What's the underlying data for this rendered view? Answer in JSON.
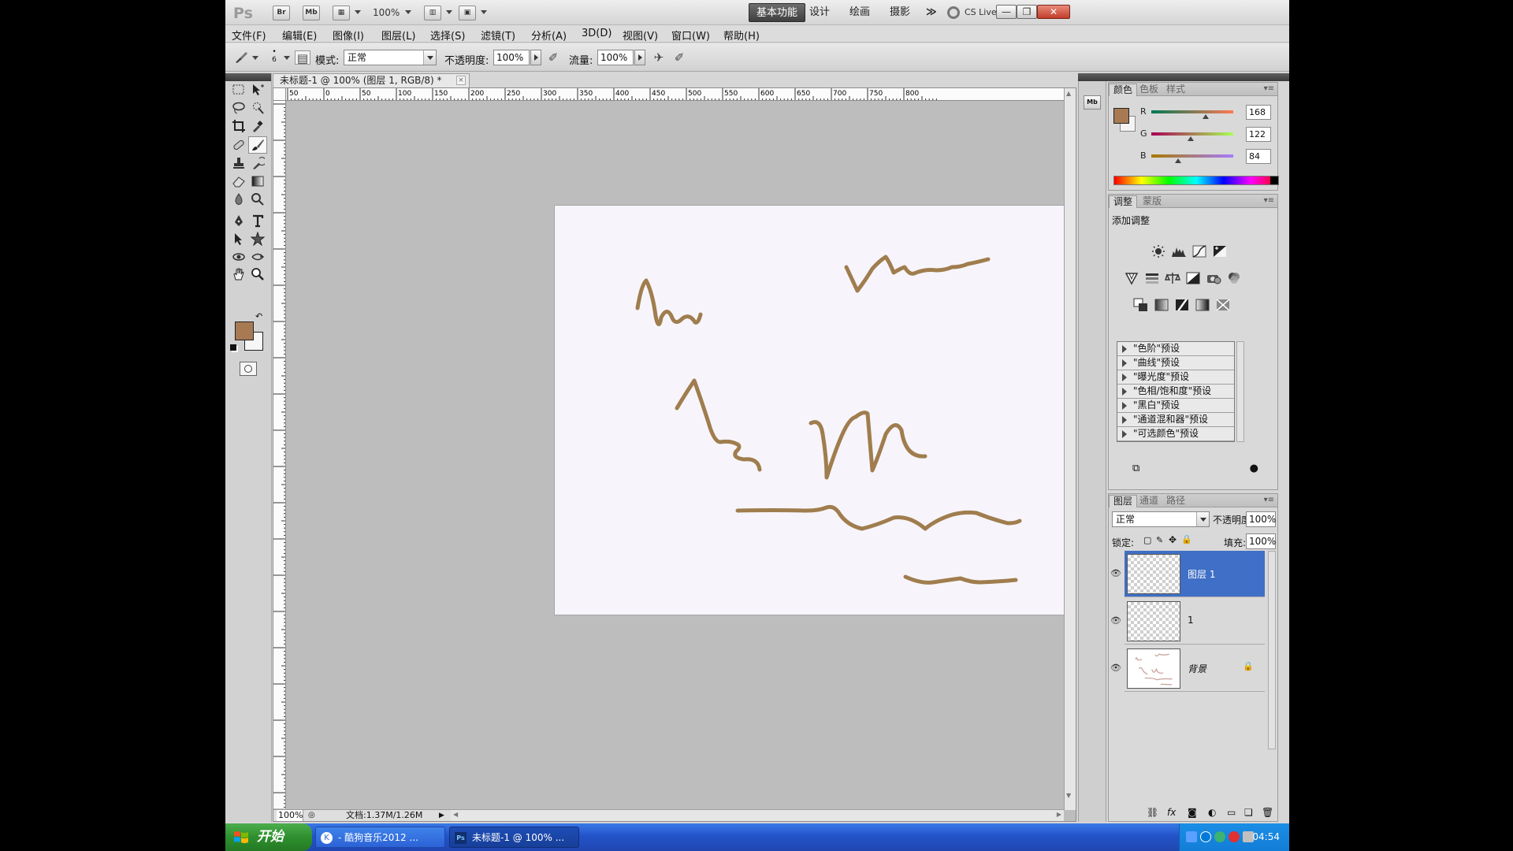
{
  "app": {
    "logo": "Ps",
    "bridge": "Br",
    "minibridge": "Mb",
    "zoom": "100%",
    "workspaces": [
      "基本功能",
      "设计",
      "绘画",
      "摄影"
    ],
    "more": "≫",
    "cslive": "CS Live"
  },
  "menu": [
    "文件(F)",
    "编辑(E)",
    "图像(I)",
    "图层(L)",
    "选择(S)",
    "滤镜(T)",
    "分析(A)",
    "3D(D)",
    "视图(V)",
    "窗口(W)",
    "帮助(H)"
  ],
  "options": {
    "brush_size": "6",
    "mode_label": "模式:",
    "mode_value": "正常",
    "opacity_label": "不透明度:",
    "opacity_value": "100%",
    "flow_label": "流量:",
    "flow_value": "100%"
  },
  "document": {
    "tab_title": "未标题-1 @ 100% (图层 1, RGB/8) *",
    "tab_close": "×",
    "ruler_top": [
      "50",
      "0",
      "50",
      "100",
      "150",
      "200",
      "250",
      "300",
      "350",
      "400",
      "450",
      "500",
      "550",
      "600",
      "650",
      "700",
      "750",
      "800"
    ],
    "status_zoom": "100%",
    "status_doc": "文档:1.37M/1.26M",
    "stroke_color": "#a07d4e"
  },
  "color_panel": {
    "tabs": [
      "颜色",
      "色板",
      "样式"
    ],
    "fg_color": "#a87a54",
    "r": "168",
    "g": "122",
    "b": "84",
    "r_level": 0.66,
    "g_level": 0.48,
    "b_level": 0.33
  },
  "adjust_panel": {
    "tabs": [
      "调整",
      "蒙版"
    ],
    "heading": "添加调整",
    "presets": [
      "\"色阶\"预设",
      "\"曲线\"预设",
      "\"曝光度\"预设",
      "\"色相/饱和度\"预设",
      "\"黑白\"预设",
      "\"通道混和器\"预设",
      "\"可选颜色\"预设"
    ]
  },
  "layers_panel": {
    "tabs": [
      "图层",
      "通道",
      "路径"
    ],
    "blend_mode": "正常",
    "opacity_label": "不透明度:",
    "opacity_value": "100%",
    "lock_label": "锁定:",
    "fill_label": "填充:",
    "fill_value": "100%",
    "layers": [
      {
        "name": "图层 1"
      },
      {
        "name": "1"
      },
      {
        "name": "背景"
      }
    ]
  },
  "taskbar": {
    "start": "开始",
    "tasks": [
      "- 酷狗音乐2012 ...",
      "未标题-1 @ 100% ..."
    ],
    "clock": "04:54"
  }
}
